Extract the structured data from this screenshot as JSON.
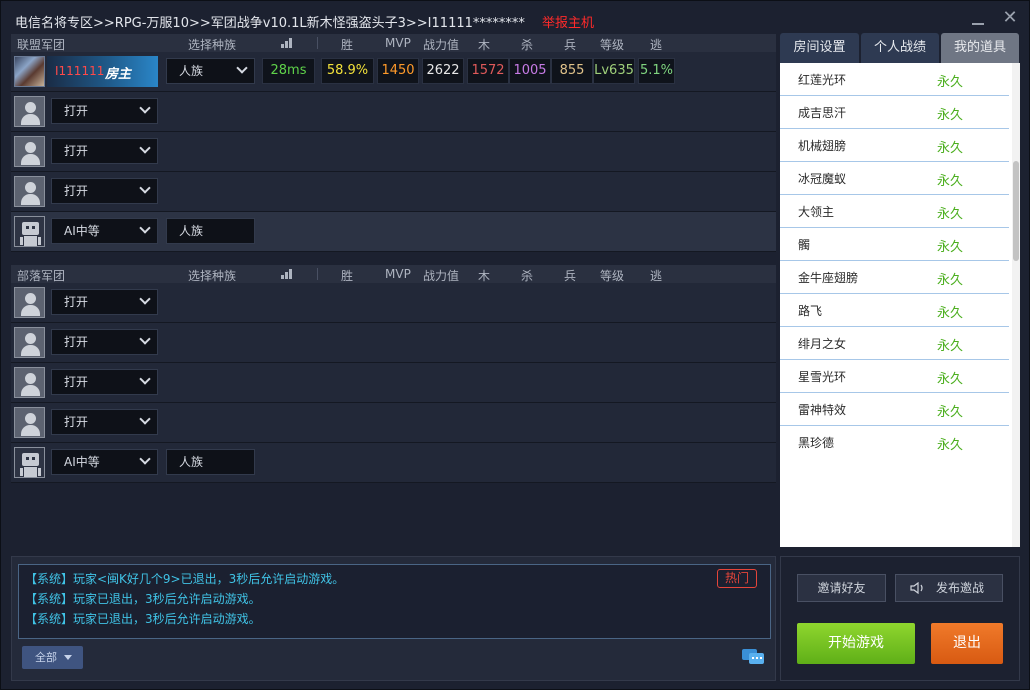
{
  "title": {
    "path": "电信名将专区>>RPG-万服10>>军团战争v10.1L新木怪强盗头子3>>I11111********",
    "report": "举报主机"
  },
  "headers": {
    "race": "选择种族",
    "win": "胜",
    "mvp": "MVP",
    "power": "战力值",
    "wood": "木",
    "kill": "杀",
    "soldier": "兵",
    "level": "等级",
    "escape": "逃"
  },
  "team_a": {
    "name": "联盟军团",
    "host": {
      "name": "I111111",
      "badge": "房主",
      "race": "人族",
      "ping": "28ms",
      "win_rate": "58.9%",
      "mvp": "1450",
      "power": "2622",
      "wood": "1572",
      "kills": "1005",
      "soldiers": "855",
      "level": "Lv635",
      "escape_rate": "5.1%"
    },
    "slots": [
      "打开",
      "打开",
      "打开"
    ],
    "ai": {
      "difficulty": "AI中等",
      "race": "人族"
    }
  },
  "team_b": {
    "name": "部落军团",
    "slots": [
      "打开",
      "打开",
      "打开",
      "打开"
    ],
    "ai": {
      "difficulty": "AI中等",
      "race": "人族"
    }
  },
  "tabs": [
    "房间设置",
    "个人战绩",
    "我的道具"
  ],
  "items": [
    {
      "name": "红莲光环",
      "duration": "永久"
    },
    {
      "name": "成吉思汗",
      "duration": "永久"
    },
    {
      "name": "机械翅膀",
      "duration": "永久"
    },
    {
      "name": "冰冠魔蚁",
      "duration": "永久"
    },
    {
      "name": "大领主",
      "duration": "永久"
    },
    {
      "name": "髑",
      "duration": "永久"
    },
    {
      "name": "金牛座翅膀",
      "duration": "永久"
    },
    {
      "name": "路飞",
      "duration": "永久"
    },
    {
      "name": "绯月之女",
      "duration": "永久"
    },
    {
      "name": "星雪光环",
      "duration": "永久"
    },
    {
      "name": "雷神特效",
      "duration": "永久"
    },
    {
      "name": "黑珍德",
      "duration": "永久"
    }
  ],
  "chat": {
    "messages": [
      "【系统】玩家<闽K好几个9>已退出，3秒后允许启动游戏。",
      "【系统】玩家已退出，3秒后允许启动游戏。",
      "【系统】玩家已退出，3秒后允许启动游戏。"
    ],
    "hot": "热门",
    "filter": "全部"
  },
  "actions": {
    "invite": "邀请好友",
    "publish": "发布邀战",
    "start": "开始游戏",
    "quit": "退出"
  },
  "colors": {
    "ping": "#5fd24a",
    "win_rate": "#f3e23a",
    "mvp": "#ff9a2a",
    "power": "#e8e8e8",
    "wood": "#e05a5a",
    "kills": "#c77be6",
    "soldiers": "#e0c28a",
    "level": "#9fd07a",
    "escape_rate": "#7fd47f"
  }
}
